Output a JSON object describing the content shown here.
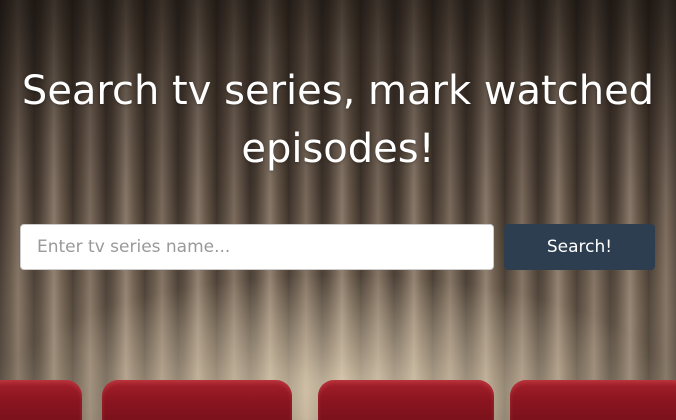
{
  "hero": {
    "title": "Search tv series, mark watched episodes!"
  },
  "search": {
    "placeholder": "Enter tv series name...",
    "value": "",
    "button_label": "Search!"
  },
  "colors": {
    "button_bg": "#2c3e50",
    "title_text": "#ffffff",
    "seat_red": "#8a1520"
  }
}
